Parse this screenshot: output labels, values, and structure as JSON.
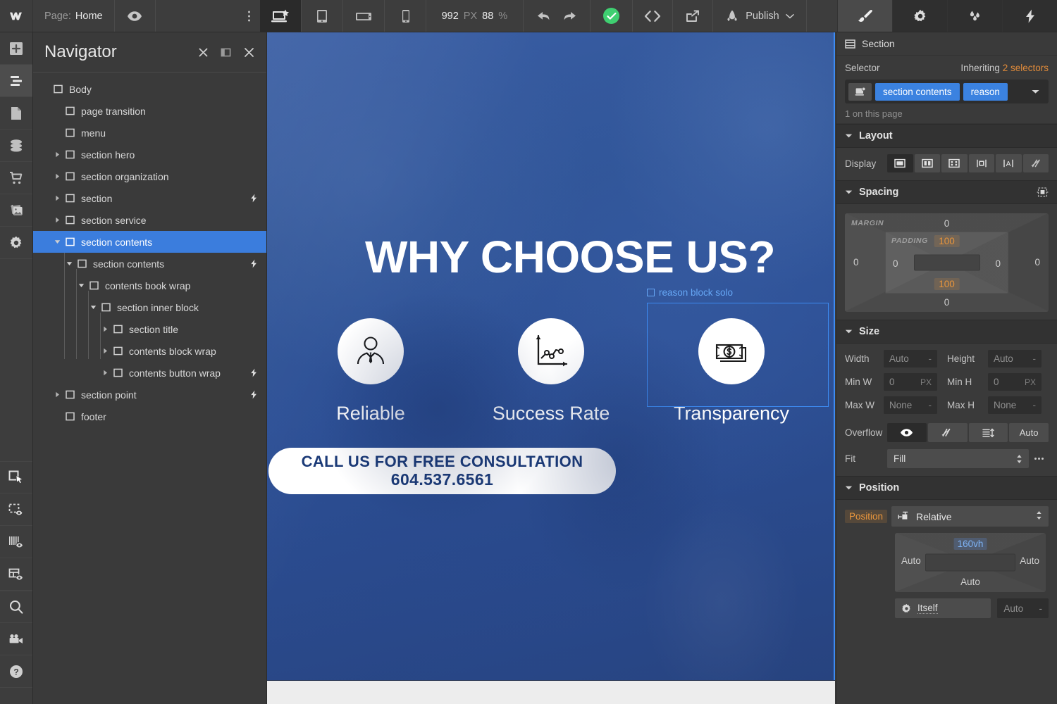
{
  "topbar": {
    "logo": "webflow-logo",
    "page_key": "Page:",
    "page_value": "Home",
    "preview_icon": "eye-icon",
    "more_icon": "more-vertical-icon",
    "devices": [
      {
        "name": "desktop",
        "icon": "desktop-icon",
        "active": true
      },
      {
        "name": "tablet",
        "icon": "tablet-icon",
        "active": false
      },
      {
        "name": "mobile-landscape",
        "icon": "mobile-landscape-icon",
        "active": false
      },
      {
        "name": "mobile-portrait",
        "icon": "mobile-portrait-icon",
        "active": false
      }
    ],
    "canvas_width": "992",
    "canvas_width_unit": "PX",
    "zoom": "88",
    "zoom_unit": "%",
    "undo_icon": "undo-icon",
    "redo_icon": "redo-icon",
    "saved_icon": "check-circle-icon",
    "code_icon": "code-icon",
    "export_icon": "export-icon",
    "publish_icon": "rocket-icon",
    "publish_label": "Publish",
    "right_tabs": [
      {
        "name": "style",
        "icon": "paintbrush-icon",
        "active": true
      },
      {
        "name": "settings",
        "icon": "gear-icon",
        "active": false
      },
      {
        "name": "style-manager",
        "icon": "droplets-icon",
        "active": false
      },
      {
        "name": "interactions",
        "icon": "lightning-icon",
        "active": false
      }
    ]
  },
  "lefttools": {
    "items": [
      {
        "name": "add-elements",
        "icon": "plus-icon",
        "active": false
      },
      {
        "name": "navigator",
        "icon": "navigator-icon",
        "active": true
      },
      {
        "name": "pages",
        "icon": "page-icon",
        "active": false
      },
      {
        "name": "cms",
        "icon": "database-icon",
        "active": false
      },
      {
        "name": "ecommerce",
        "icon": "cart-icon",
        "active": false
      },
      {
        "name": "assets",
        "icon": "images-icon",
        "active": false
      },
      {
        "name": "settings",
        "icon": "gear-icon",
        "active": false
      }
    ],
    "bottom_items": [
      {
        "name": "select-tool",
        "icon": "cursor-select-icon"
      },
      {
        "name": "edit-mode",
        "icon": "dashed-box-eye-icon"
      },
      {
        "name": "guides",
        "icon": "guides-eye-icon"
      },
      {
        "name": "grid-overlay",
        "icon": "layout-eye-icon"
      },
      {
        "name": "search",
        "icon": "search-icon"
      },
      {
        "name": "video-tutorials",
        "icon": "video-camera-icon"
      },
      {
        "name": "help",
        "icon": "question-circle-icon"
      }
    ]
  },
  "navigator": {
    "title": "Navigator",
    "actions": [
      {
        "name": "collapse-all",
        "icon": "collapse-x-icon"
      },
      {
        "name": "dock-panel",
        "icon": "panel-dock-icon"
      },
      {
        "name": "close-panel",
        "icon": "close-x-icon"
      }
    ],
    "tree": [
      {
        "label": "Body",
        "depth": 0,
        "icon": "body-icon",
        "caret": "none",
        "bolt": false,
        "selected": false
      },
      {
        "label": "page transition",
        "depth": 1,
        "icon": "div-icon",
        "caret": "none",
        "bolt": false,
        "selected": false
      },
      {
        "label": "menu",
        "depth": 1,
        "icon": "symbol-icon",
        "caret": "none",
        "bolt": false,
        "selected": false
      },
      {
        "label": "section hero",
        "depth": 1,
        "icon": "section-icon",
        "caret": "closed",
        "bolt": false,
        "selected": false
      },
      {
        "label": "section organization",
        "depth": 1,
        "icon": "section-icon",
        "caret": "closed",
        "bolt": false,
        "selected": false
      },
      {
        "label": "section",
        "depth": 1,
        "icon": "section-icon",
        "caret": "closed",
        "bolt": true,
        "selected": false
      },
      {
        "label": "section service",
        "depth": 1,
        "icon": "section-icon",
        "caret": "closed",
        "bolt": false,
        "selected": false
      },
      {
        "label": "section contents",
        "depth": 1,
        "icon": "section-icon",
        "caret": "open",
        "bolt": false,
        "selected": true
      },
      {
        "label": "section contents",
        "depth": 2,
        "icon": "div-icon",
        "caret": "open",
        "bolt": true,
        "selected": false
      },
      {
        "label": "contents book wrap",
        "depth": 3,
        "icon": "div-icon",
        "caret": "open",
        "bolt": false,
        "selected": false
      },
      {
        "label": "section inner block",
        "depth": 4,
        "icon": "div-icon",
        "caret": "open",
        "bolt": false,
        "selected": false
      },
      {
        "label": "section title",
        "depth": 5,
        "icon": "div-icon",
        "caret": "closed",
        "bolt": false,
        "selected": false
      },
      {
        "label": "contents block wrap",
        "depth": 5,
        "icon": "div-icon",
        "caret": "closed",
        "bolt": false,
        "selected": false
      },
      {
        "label": "contents button wrap",
        "depth": 5,
        "icon": "div-icon",
        "caret": "closed",
        "bolt": true,
        "selected": false
      },
      {
        "label": "section point",
        "depth": 1,
        "icon": "section-icon",
        "caret": "closed",
        "bolt": true,
        "selected": false
      },
      {
        "label": "footer",
        "depth": 1,
        "icon": "symbol-icon",
        "caret": "none",
        "bolt": false,
        "selected": false
      }
    ]
  },
  "canvas": {
    "heading": "WHY CHOOSE US?",
    "features": [
      {
        "label": "Reliable",
        "icon": "businessperson-icon",
        "selected": false
      },
      {
        "label": "Success Rate",
        "icon": "line-chart-icon",
        "selected": false
      },
      {
        "label": "Transparency",
        "icon": "dollar-bill-icon",
        "selected": true
      }
    ],
    "selection_tag": "reason block solo",
    "cta_line1": "CALL US FOR FREE CONSULTATION",
    "cta_line2": "604.537.6561",
    "colors": {
      "section_blue": "#2d5096",
      "cta_text": "#1b3a77",
      "selection": "#3d8bf2",
      "next_section": "#ededed"
    }
  },
  "rightpanel": {
    "element_type": "Section",
    "element_icon": "section-icon",
    "selector": {
      "label": "Selector",
      "inherit_prefix": "Inheriting",
      "inherit_count": "2 selectors",
      "state_icon": "element-state-icon",
      "chips": [
        "section contents",
        "reason"
      ],
      "caret_icon": "chevron-down-icon",
      "count_text": "1 on this page"
    },
    "layout": {
      "title": "Layout",
      "display_label": "Display",
      "display_options": [
        {
          "name": "block",
          "icon": "display-block-icon",
          "active": true
        },
        {
          "name": "flex",
          "icon": "display-flex-icon",
          "active": false
        },
        {
          "name": "grid",
          "icon": "display-grid-icon",
          "active": false
        },
        {
          "name": "inline-block",
          "icon": "display-inline-icon",
          "active": false
        },
        {
          "name": "inline",
          "icon": "display-text-icon",
          "active": false
        },
        {
          "name": "none",
          "icon": "display-none-icon",
          "active": false
        }
      ]
    },
    "spacing": {
      "title": "Spacing",
      "mode_icon": "spacing-mode-icon",
      "margin_label": "MARGIN",
      "padding_label": "PADDING",
      "margin": {
        "top": "0",
        "right": "0",
        "bottom": "0",
        "left": "0"
      },
      "padding": {
        "top": "100",
        "right": "0",
        "bottom": "100",
        "left": "0"
      }
    },
    "size": {
      "title": "Size",
      "width_label": "Width",
      "width_value": "Auto",
      "width_unit": "-",
      "height_label": "Height",
      "height_value": "Auto",
      "height_unit": "-",
      "minw_label": "Min W",
      "minw_value": "0",
      "minw_unit": "PX",
      "minh_label": "Min H",
      "minh_value": "0",
      "minh_unit": "PX",
      "maxw_label": "Max W",
      "maxw_value": "None",
      "maxw_unit": "-",
      "maxh_label": "Max H",
      "maxh_value": "None",
      "maxh_unit": "-",
      "overflow_label": "Overflow",
      "overflow_options": [
        {
          "name": "visible",
          "icon": "eye-icon",
          "label": "",
          "active": true
        },
        {
          "name": "hidden",
          "icon": "eye-off-icon",
          "label": "",
          "active": false
        },
        {
          "name": "scroll",
          "icon": "scroll-icon",
          "label": "",
          "active": false
        },
        {
          "name": "auto",
          "icon": "",
          "label": "Auto",
          "active": false
        }
      ],
      "fit_label": "Fit",
      "fit_value": "Fill",
      "fit_more_icon": "more-horizontal-icon"
    },
    "position": {
      "title": "Position",
      "label": "Position",
      "mode_icon": "position-relative-icon",
      "mode_value": "Relative",
      "top": "160vh",
      "right": "Auto",
      "bottom": "Auto",
      "left": "Auto",
      "z_label": "Itself",
      "z_icon": "gear-icon",
      "z_value": "Auto",
      "z_unit": "-"
    }
  }
}
